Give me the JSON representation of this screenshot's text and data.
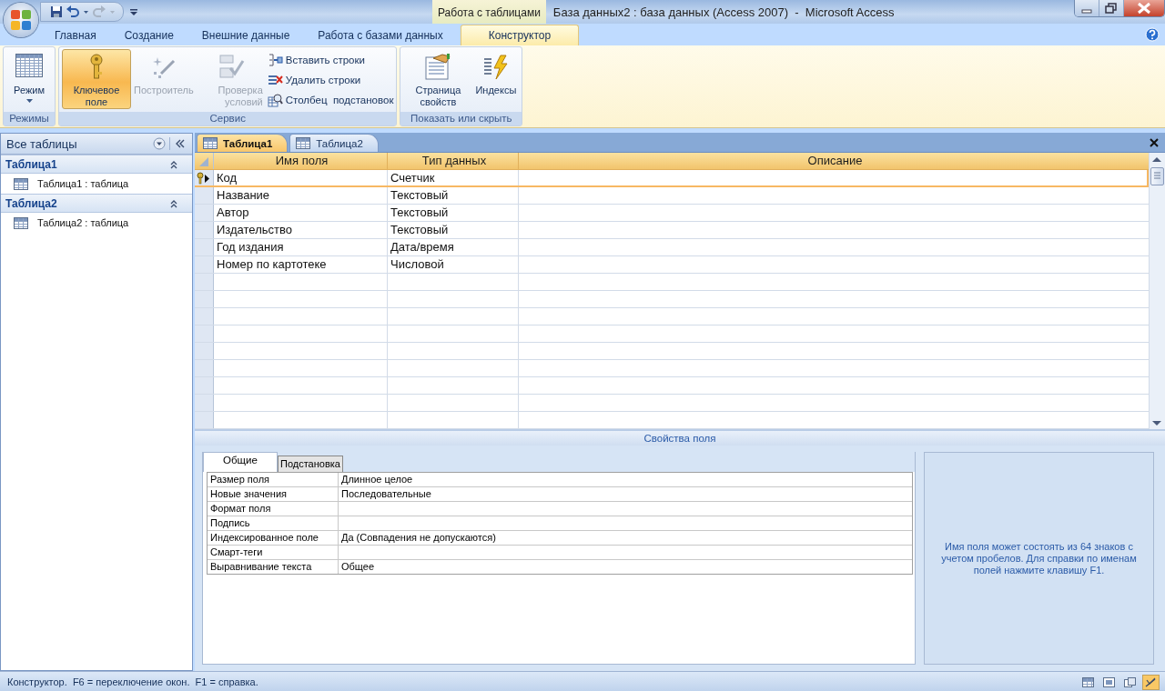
{
  "window": {
    "title": "База данных2 : база данных (Access 2007)  -  Microsoft Access",
    "context_tab": "Работа с таблицами"
  },
  "ribbon": {
    "tabs": [
      {
        "label": "Главная",
        "selected": false
      },
      {
        "label": "Создание",
        "selected": false
      },
      {
        "label": "Внешние данные",
        "selected": false
      },
      {
        "label": "Работа с базами данных",
        "selected": false
      },
      {
        "label": "Конструктор",
        "selected": true
      }
    ],
    "groups": [
      {
        "label": "Режимы",
        "buttons": [
          {
            "label": "Режим",
            "kind": "large",
            "dropdown": true,
            "on": false,
            "disabled": false
          }
        ]
      },
      {
        "label": "Сервис",
        "buttons": [
          {
            "label": "Ключевое поле",
            "kind": "large",
            "on": true,
            "disabled": false
          },
          {
            "label": "Построитель",
            "kind": "large",
            "on": false,
            "disabled": true
          },
          {
            "label": "Проверка условий",
            "kind": "large",
            "on": false,
            "disabled": true
          },
          {
            "label": "Вставить строки",
            "kind": "small"
          },
          {
            "label": "Удалить строки",
            "kind": "small"
          },
          {
            "label": "Столбец  подстановок",
            "kind": "small"
          }
        ]
      },
      {
        "label": "Показать или скрыть",
        "buttons": [
          {
            "label": "Страница свойств",
            "kind": "large",
            "on": false,
            "disabled": false
          },
          {
            "label": "Индексы",
            "kind": "large",
            "on": false,
            "disabled": false
          }
        ]
      }
    ]
  },
  "nav": {
    "title": "Все таблицы",
    "groups": [
      {
        "label": "Таблица1",
        "expanded": true,
        "items": [
          "Таблица1 : таблица"
        ]
      },
      {
        "label": "Таблица2",
        "expanded": true,
        "items": [
          "Таблица2 : таблица"
        ]
      }
    ]
  },
  "doc_tabs": [
    {
      "label": "Таблица1",
      "selected": true
    },
    {
      "label": "Таблица2",
      "selected": false
    }
  ],
  "grid": {
    "columns": [
      "Имя поля",
      "Тип данных",
      "Описание"
    ],
    "rows": [
      {
        "name": "Код",
        "type": "Счетчик",
        "primary_key": true,
        "selected": true
      },
      {
        "name": "Название",
        "type": "Текстовый",
        "primary_key": false,
        "selected": false
      },
      {
        "name": "Автор",
        "type": "Текстовый",
        "primary_key": false,
        "selected": false
      },
      {
        "name": "Издательство",
        "type": "Текстовый",
        "primary_key": false,
        "selected": false
      },
      {
        "name": "Год издания",
        "type": "Дата/время",
        "primary_key": false,
        "selected": false
      },
      {
        "name": "Номер по картотеке",
        "type": "Числовой",
        "primary_key": false,
        "selected": false
      }
    ]
  },
  "properties": {
    "title": "Свойства поля",
    "tabs": [
      {
        "label": "Общие",
        "selected": true
      },
      {
        "label": "Подстановка",
        "selected": false
      }
    ],
    "rows": [
      {
        "label": "Размер поля",
        "value": "Длинное целое"
      },
      {
        "label": "Новые значения",
        "value": "Последовательные"
      },
      {
        "label": "Формат поля"
      },
      {
        "label": "Подпись"
      },
      {
        "label": "Индексированное поле",
        "value": "Да (Совпадения не допускаются)"
      },
      {
        "label": "Смарт-теги"
      },
      {
        "label": "Выравнивание текста",
        "value": "Общее"
      }
    ],
    "help": "Имя поля может состоять из 64 знаков с учетом пробелов.  Для справки по именам полей нажмите клавишу F1."
  },
  "status_bar": {
    "text": "Конструктор.  F6 = переключение окон.  F1 = справка.",
    "views": [
      {
        "selected": false
      },
      {
        "selected": false
      },
      {
        "selected": false
      },
      {
        "selected": true
      }
    ]
  }
}
